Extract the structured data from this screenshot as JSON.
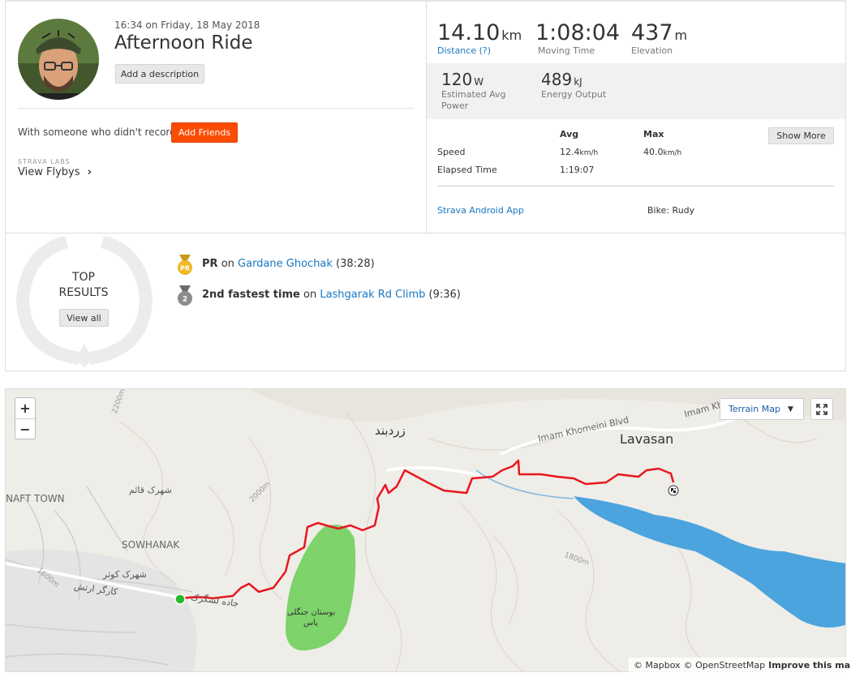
{
  "activity": {
    "timestamp": "16:34 on Friday, 18 May 2018",
    "title": "Afternoon Ride",
    "add_description": "Add a description",
    "someone_prompt": "With someone who didn't record?",
    "add_friends": "Add Friends",
    "labs": "STRAVA LABS",
    "flybys": "View Flybys"
  },
  "stats": {
    "distance": {
      "value": "14.10",
      "unit": "km",
      "label": "Distance (?)"
    },
    "moving_time": {
      "value": "1:08:04",
      "label": "Moving Time"
    },
    "elevation": {
      "value": "437",
      "unit": "m",
      "label": "Elevation"
    },
    "avg_power": {
      "value": "120",
      "unit": "W",
      "label_line1": "Estimated Avg",
      "label_line2": "Power"
    },
    "energy": {
      "value": "489",
      "unit": "kJ",
      "label": "Energy Output"
    }
  },
  "details": {
    "col_avg": "Avg",
    "col_max": "Max",
    "show_more": "Show More",
    "speed_label": "Speed",
    "speed_avg": "12.4",
    "speed_max": "40.0",
    "speed_unit": "km/h",
    "elapsed_label": "Elapsed Time",
    "elapsed_value": "1:19:07",
    "device": "Strava Android App",
    "bike": "Bike: Rudy"
  },
  "results": {
    "heading_line1": "TOP",
    "heading_line2": "RESULTS",
    "view_all": "View all",
    "items": [
      {
        "badge": "PR",
        "rank_text": "PR",
        "on": "on",
        "segment": "Gardane Ghochak",
        "time": "(38:28)"
      },
      {
        "badge": "2",
        "rank_text": "2nd fastest time",
        "on": "on",
        "segment": "Lashgarak Rd Climb",
        "time": "(9:36)"
      }
    ]
  },
  "map": {
    "zoom_in": "+",
    "zoom_out": "−",
    "layer_select": "Terrain Map",
    "attribution_mapbox": "© Mapbox",
    "attribution_osm": "© OpenStreetMap",
    "improve": "Improve this map",
    "labels": {
      "lavasan": "Lavasan",
      "zardband": "زردبند",
      "naft_town": "NAFT TOWN",
      "sowhanak": "SOWHANAK",
      "imam_blvd": "Imam Khomeini Blvd",
      "imam_blvd_2": "Imam Kh",
      "shahrak_qaem": "شهرک قائم",
      "shahrak_kowsar": "شهرک کوثر",
      "park": "بوستان جنگلی",
      "park2": "یاس",
      "kargar": "کارگر ارتش",
      "lashgarak": "جاده لشگرک",
      "elev_2200": "2200m",
      "elev_2000": "2000m",
      "elev_1800": "1800m",
      "elev_1600": "1600m"
    }
  },
  "colors": {
    "brand": "#fc4c02",
    "link": "#1a78c2",
    "route": "#e8161e",
    "lake": "#4ba4de",
    "park": "#7ed36b"
  }
}
